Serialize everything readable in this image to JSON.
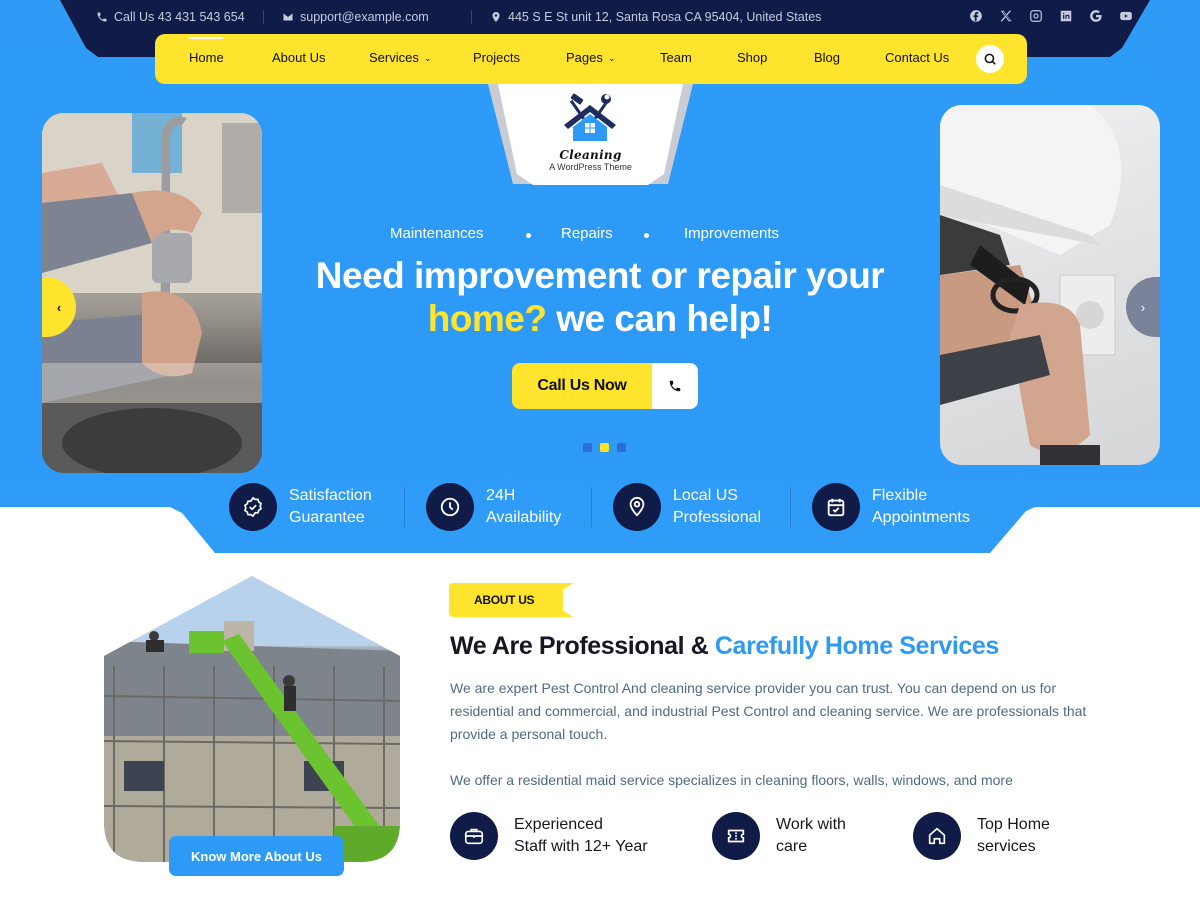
{
  "topbar": {
    "phone": "Call Us 43 431 543 654",
    "email": "support@example.com",
    "address": "445 S E St unit 12, Santa Rosa CA 95404, United States",
    "socials": [
      "facebook-icon",
      "x-icon",
      "instagram-icon",
      "linkedin-icon",
      "google-icon",
      "youtube-icon"
    ]
  },
  "nav": {
    "items": [
      {
        "label": "Home",
        "active": true
      },
      {
        "label": "About Us"
      },
      {
        "label": "Services",
        "dropdown": true
      },
      {
        "label": "Projects"
      },
      {
        "label": "Pages",
        "dropdown": true
      },
      {
        "label": "Team"
      },
      {
        "label": "Shop"
      },
      {
        "label": "Blog"
      },
      {
        "label": "Contact Us"
      }
    ],
    "chevron": "⌄",
    "search_icon": "search-icon"
  },
  "logo": {
    "title": "Cleaning",
    "subtitle": "A WordPress Theme"
  },
  "hero": {
    "tags": [
      "Maintenances",
      "Repairs",
      "Improvements"
    ],
    "title_line1": "Need improvement or repair your",
    "title_highlight": "home?",
    "title_line2_rest": " we can help!",
    "cta_label": "Call Us Now",
    "prev_arrow": "‹",
    "next_arrow": "›",
    "slides_total": 3,
    "slide_active": 2
  },
  "features": [
    {
      "line1": "Satisfaction",
      "line2": "Guarantee",
      "icon": "badge-check-icon"
    },
    {
      "line1": "24H",
      "line2": "Availability",
      "icon": "clock-icon"
    },
    {
      "line1": "Local US",
      "line2": "Professional",
      "icon": "location-pin-icon"
    },
    {
      "line1": "Flexible",
      "line2": "Appointments",
      "icon": "calendar-check-icon"
    }
  ],
  "about": {
    "badge": "ABOUT US",
    "title_main": "We Are Professional & ",
    "title_highlight": "Carefully Home Services",
    "paragraph1": "We are expert Pest Control And cleaning service provider you can trust. You can depend on us for residential and commercial, and industrial Pest Control and cleaning service. We are professionals that  provide a personal touch.",
    "paragraph2": "We offer a residential maid service specializes in cleaning floors, walls, windows, and more",
    "button": "Know More About Us",
    "features": [
      {
        "line1": "Experienced",
        "line2": "Staff with 12+ Year",
        "icon": "briefcase-icon"
      },
      {
        "line1": "Work with",
        "line2": "care",
        "icon": "ticket-icon"
      },
      {
        "line1": "Top Home",
        "line2": "services",
        "icon": "home-icon"
      }
    ]
  },
  "colors": {
    "primary_blue": "#2d9af8",
    "navy": "#101b48",
    "yellow": "#ffe42d",
    "body_text": "#4f6a86"
  }
}
